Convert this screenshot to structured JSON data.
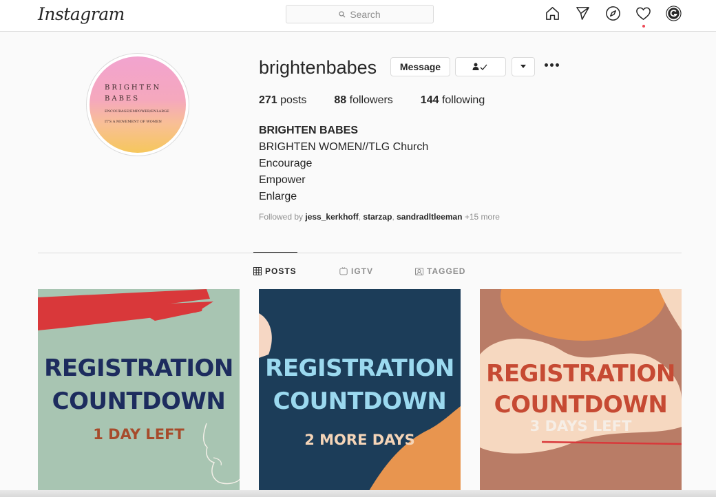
{
  "nav": {
    "logo": "Instagram",
    "search_placeholder": "Search",
    "icons": [
      "home-icon",
      "direct-icon",
      "explore-icon",
      "activity-icon",
      "profile-icon"
    ]
  },
  "profile": {
    "username": "brightenbabes",
    "message_label": "Message",
    "avatar": {
      "line1": "BRIGHTEN",
      "line2": "BABES",
      "line3": "ENCOURAGE/EMPOWER/ENLARGE",
      "line4": "IT'S A MOVEMENT OF WOMEN"
    },
    "stats": {
      "posts_count": "271",
      "posts_label": "posts",
      "followers_count": "88",
      "followers_label": "followers",
      "following_count": "144",
      "following_label": "following"
    },
    "bio": {
      "name": "BRIGHTEN BABES",
      "lines": [
        "BRIGHTEN WOMEN//TLG Church",
        "Encourage",
        "Empower",
        "Enlarge"
      ]
    },
    "followed_by": {
      "prefix": "Followed by",
      "users": [
        "jess_kerkhoff",
        "starzap",
        "sandradltleeman"
      ],
      "more": "+15 more"
    }
  },
  "tabs": [
    {
      "label": "POSTS",
      "active": true
    },
    {
      "label": "IGTV",
      "active": false
    },
    {
      "label": "TAGGED",
      "active": false
    }
  ],
  "posts": [
    {
      "line1": "REGISTRATION",
      "line2": "COUNTDOWN",
      "line3": "1 DAY LEFT"
    },
    {
      "line1": "REGISTRATION",
      "line2": "COUNTDOWN",
      "line3": "2 MORE DAYS"
    },
    {
      "line1": "REGISTRATION",
      "line2": "COUNTDOWN",
      "line3": "3 DAYS LEFT"
    }
  ],
  "colors": {
    "post1_bg": "#a8c5b2",
    "post2_bg": "#1c3d59",
    "post3_bg": "#b97c66",
    "notification_dot": "#ed4956"
  }
}
